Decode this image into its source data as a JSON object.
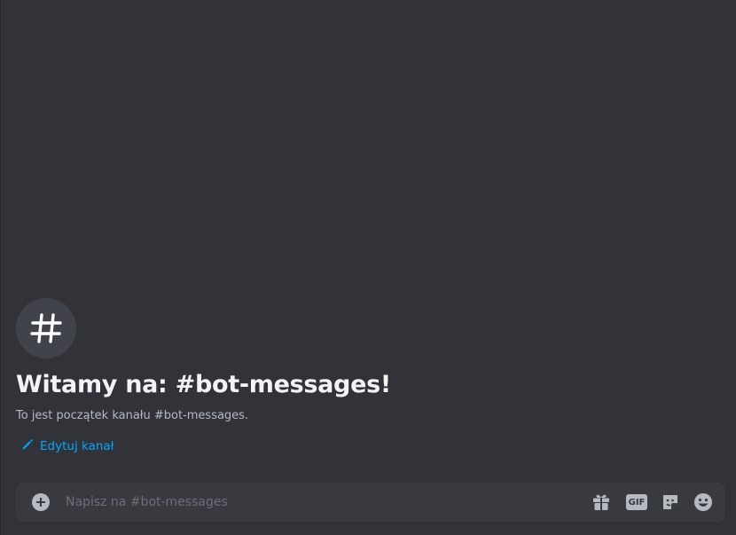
{
  "welcome": {
    "icon": "hash-icon",
    "title": "Witamy na: #bot-messages!",
    "subtitle": "To jest początek kanału #bot-messages.",
    "edit_label": "Edytuj kanał",
    "edit_icon": "pencil-icon"
  },
  "composer": {
    "placeholder": "Napisz na #bot-messages",
    "attach_icon": "plus-circle-icon",
    "tools": {
      "gift_icon": "gift-icon",
      "gif_label": "GIF",
      "sticker_icon": "sticker-icon",
      "emoji_icon": "emoji-icon"
    }
  },
  "colors": {
    "background": "#313338",
    "composer_bg": "#383a40",
    "title": "#f2f3f5",
    "muted_text": "#b5bac1",
    "link": "#00a8fc"
  }
}
